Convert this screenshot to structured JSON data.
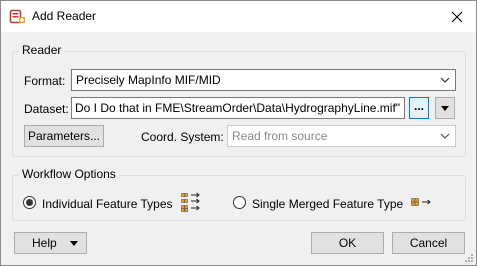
{
  "dialog": {
    "title": "Add Reader",
    "close_icon": "close-icon"
  },
  "reader_group": {
    "title": "Reader",
    "format_label": "Format:",
    "format_value": "Precisely MapInfo MIF/MID",
    "dataset_label": "Dataset:",
    "dataset_value": "Do I Do that in FME\\StreamOrder\\Data\\HydrographyLine.mif\"",
    "browse_label": "...",
    "parameters_label": "Parameters...",
    "coord_label": "Coord. System:",
    "coord_placeholder": "Read from source"
  },
  "workflow_group": {
    "title": "Workflow Options",
    "option_individual": "Individual Feature Types",
    "option_individual_checked": true,
    "option_merged": "Single Merged Feature Type",
    "option_merged_checked": false
  },
  "footer": {
    "help_label": "Help",
    "ok_label": "OK",
    "cancel_label": "Cancel"
  }
}
